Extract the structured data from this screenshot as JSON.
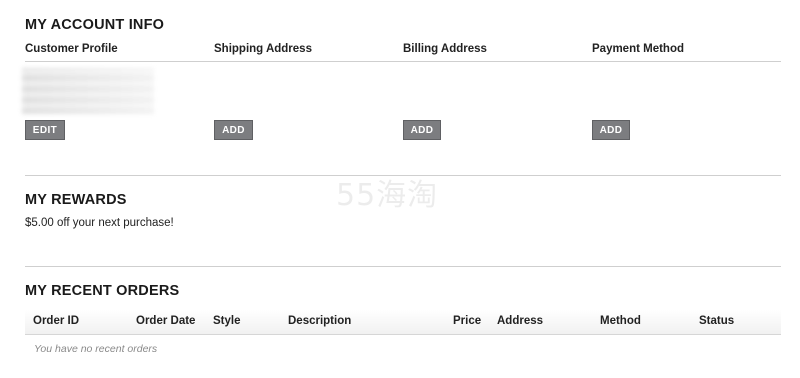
{
  "account": {
    "title": "MY ACCOUNT INFO",
    "columns": [
      {
        "label": "Customer Profile",
        "button": "EDIT"
      },
      {
        "label": "Shipping Address",
        "button": "ADD"
      },
      {
        "label": "Billing Address",
        "button": "ADD"
      },
      {
        "label": "Payment Method",
        "button": "ADD"
      }
    ]
  },
  "rewards": {
    "title": "MY REWARDS",
    "text": "$5.00 off your next purchase!"
  },
  "orders": {
    "title": "MY RECENT ORDERS",
    "columns": [
      "Order ID",
      "Order Date",
      "Style",
      "Description",
      "Price",
      "Address",
      "Method",
      "Status"
    ],
    "empty_message": "You have no recent orders"
  },
  "watermark": {
    "text": "55海淘"
  },
  "colors": {
    "button_bg": "#7c7d80",
    "rule": "#cfcfcf"
  }
}
